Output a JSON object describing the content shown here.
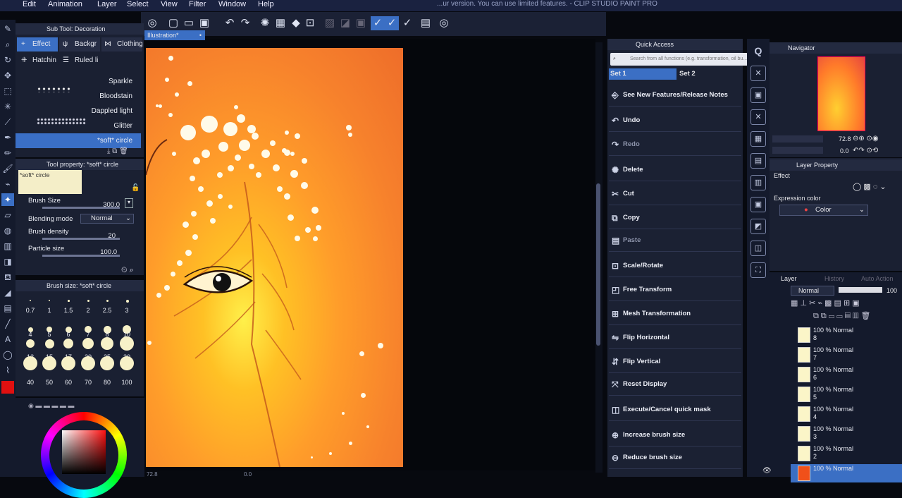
{
  "menu": {
    "items": [
      "Edit",
      "Animation",
      "Layer",
      "Select",
      "View",
      "Filter",
      "Window",
      "Help"
    ],
    "app_title": "...ur version. You can use limited features. - CLIP STUDIO PAINT PRO"
  },
  "canvas_tab": {
    "label": "Illustration*"
  },
  "subtool": {
    "header": "Sub Tool: Decoration",
    "tabs": [
      "Effect",
      "Backgr",
      "Clothing",
      "Hatchin",
      "Ruled li"
    ],
    "brushes": [
      "Sparkle",
      "Bloodstain",
      "Dappled light",
      "Glitter",
      "*soft* circle"
    ]
  },
  "tool_property": {
    "header": "Tool property: *soft* circle",
    "preview_label": "*soft* circle",
    "brush_size_label": "Brush Size",
    "brush_size_value": "300.0",
    "blending_mode_label": "Blending mode",
    "blending_mode_value": "Normal",
    "brush_density_label": "Brush density",
    "brush_density_value": "20",
    "particle_size_label": "Particle size",
    "particle_size_value": "100.0"
  },
  "brush_size": {
    "header": "Brush size: *soft* circle",
    "row1": [
      "0.7",
      "1",
      "1.5",
      "2",
      "2.5",
      "3"
    ],
    "row2": [
      "4",
      "5",
      "6",
      "7",
      "8",
      "10"
    ],
    "row3": [
      "12",
      "15",
      "17",
      "20",
      "25",
      "30"
    ],
    "row4": [
      "40",
      "50",
      "60",
      "70",
      "80",
      "100"
    ]
  },
  "quick_access": {
    "header": "Quick Access",
    "search_placeholder": "Search from all functions (e.g. transformation, oil bu...",
    "set1": "Set 1",
    "set2": "Set 2",
    "items": [
      {
        "label": "See New Features/Release Notes",
        "icon": "info-icon"
      },
      {
        "label": "Undo",
        "icon": "undo-icon"
      },
      {
        "label": "Redo",
        "icon": "redo-icon"
      },
      {
        "label": "Delete",
        "icon": "delete-icon"
      },
      {
        "label": "Cut",
        "icon": "cut-icon"
      },
      {
        "label": "Copy",
        "icon": "copy-icon"
      },
      {
        "label": "Paste",
        "icon": "paste-icon"
      },
      {
        "label": "Scale/Rotate",
        "icon": "scale-rotate-icon"
      },
      {
        "label": "Free Transform",
        "icon": "free-transform-icon"
      },
      {
        "label": "Mesh Transformation",
        "icon": "mesh-icon"
      },
      {
        "label": "Flip Horizontal",
        "icon": "flip-horizontal-icon"
      },
      {
        "label": "Flip Vertical",
        "icon": "flip-vertical-icon"
      },
      {
        "label": "Reset Display",
        "icon": "reset-display-icon"
      },
      {
        "label": "Execute/Cancel quick mask",
        "icon": "quick-mask-icon"
      },
      {
        "label": "Increase brush size",
        "icon": "increase-brush-icon"
      },
      {
        "label": "Reduce brush size",
        "icon": "reduce-brush-icon"
      }
    ]
  },
  "navigator": {
    "header": "Navigator",
    "zoom": "72.8",
    "rotation": "0.0"
  },
  "layer_property": {
    "header": "Layer Property",
    "effect_label": "Effect",
    "expression_color_label": "Expression color",
    "expression_color_value": "Color"
  },
  "layers": {
    "tabs": [
      "Layer",
      "History",
      "Auto Action"
    ],
    "blend_mode": "Normal",
    "opacity": "100",
    "rows": [
      {
        "title": "100 % Normal",
        "name": "8"
      },
      {
        "title": "100 % Normal",
        "name": "7"
      },
      {
        "title": "100 % Normal",
        "name": "6"
      },
      {
        "title": "100 % Normal",
        "name": "5"
      },
      {
        "title": "100 % Normal",
        "name": "4"
      },
      {
        "title": "100 % Normal",
        "name": "3"
      },
      {
        "title": "100 % Normal",
        "name": "2"
      },
      {
        "title": "100 % Normal",
        "name": ""
      }
    ]
  },
  "status": {
    "zoom": "72.8",
    "angle": "0.0"
  },
  "colors": {
    "accent": "#3b6fc4",
    "main_color": "#e01010"
  }
}
